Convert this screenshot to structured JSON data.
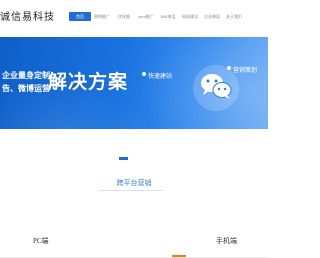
{
  "header": {
    "logo_text": "诚信易科技",
    "nav": [
      {
        "label": "首页",
        "active": true
      },
      {
        "label": "营销推广",
        "active": false
      },
      {
        "label": "优化推",
        "active": false
      },
      {
        "label": "sem推广",
        "active": false
      },
      {
        "label": "800电话",
        "active": false
      },
      {
        "label": "网站建设",
        "active": false
      },
      {
        "label": "企业邮局",
        "active": false
      },
      {
        "label": "关于我们",
        "active": false
      }
    ]
  },
  "banner": {
    "line1": "企业量身定制",
    "line2": "告、微博运营",
    "big_title": "解决方案",
    "label_left": "快速建站",
    "label_right": "营销策划",
    "wechat_icon": "wechat-icon"
  },
  "section": {
    "title": "跨平台营销"
  },
  "platforms": {
    "pc_label": "PC端",
    "mobile_label": "手机端"
  },
  "colors": {
    "accent": "#1d6ed8",
    "orange": "#f07d1a"
  }
}
